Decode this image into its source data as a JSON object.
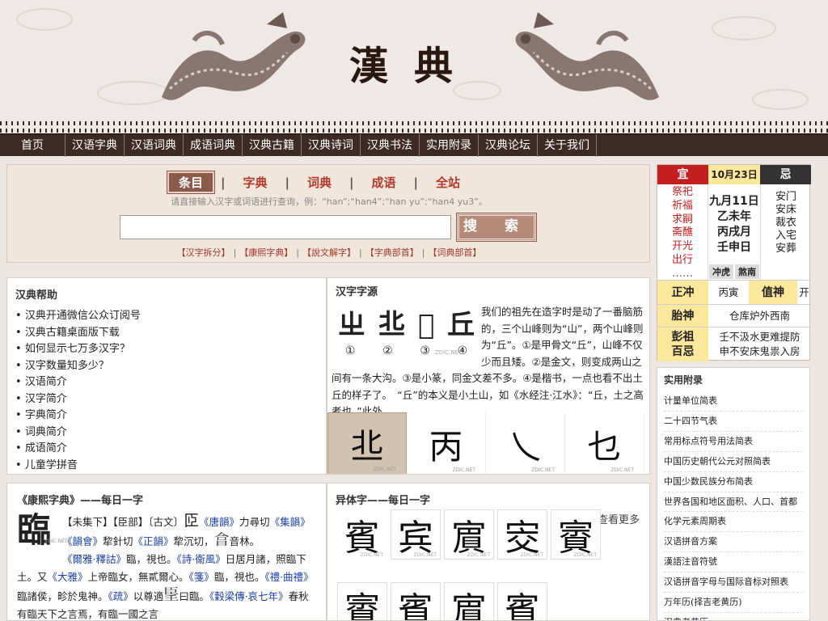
{
  "site": {
    "logo": "漢典"
  },
  "nav": [
    "首页",
    "汉语字典",
    "汉语词典",
    "成语词典",
    "汉典古籍",
    "汉典诗词",
    "汉典书法",
    "实用附录",
    "汉典论坛",
    "关于我们"
  ],
  "search": {
    "tabs": [
      "条目",
      "字典",
      "词典",
      "成语",
      "全站"
    ],
    "active_tab": "条目",
    "hint": "请直接输入汉字或词语进行查询，例：“han”;“han4”;“han yu”;“han4 yu3”。",
    "query": "",
    "button": "搜 索",
    "links": [
      "【汉字拆分】",
      "【康熙字典】",
      "【說文解字】",
      "【字典部首】",
      "【词典部首】"
    ]
  },
  "help": {
    "title": "汉典帮助",
    "items": [
      "汉典开通微信公众订阅号",
      "汉典古籍桌面版下载",
      "如何显示七万多汉字？",
      "汉字数量知多少？",
      "汉语简介",
      "汉字简介",
      "字典简介",
      "词典简介",
      "成语简介",
      "儿童学拼音"
    ]
  },
  "origin": {
    "title": "汉字字源",
    "glyph_numbers": [
      "①",
      "②",
      "③",
      "④"
    ],
    "glyphs": [
      "ㄓ",
      "丠",
      "𠀉",
      "丘"
    ],
    "watermark": "ZDIC.NET",
    "text": "我们的祖先在造字时是动了一番脑筋的，三个山峰则为“山”，两个山峰则为“丘”。①是甲骨文“丘”，山峰不仅少而且矮。②是金文，则变成两山之间有一条大沟。③是小篆，同金文差不多。④是楷书，一点也看不出土丘的样子了。　“丘”的本义是小土山，如《水经注·江水》：“丘，土之高者也。”此外，",
    "strip": [
      "丠",
      "丙",
      "乀",
      "乜"
    ],
    "strip_wm": "ZDIC.NET"
  },
  "kangxi": {
    "title": "《康熙字典》——每日一字",
    "char": "臨",
    "wm": "ZDIC.NET",
    "small1": "𦣝",
    "small2": "𦣠",
    "small3": "𣌭",
    "t1": "【未集下】【臣部】〔古文〕",
    "t2": "《唐韻》",
    "t3": "力尋切",
    "t4": "《集韻》《韻會》",
    "t5": "犂針切",
    "t6": "《正韻》",
    "t7": "犂沉切，",
    "t8": "音林。",
    "t9": "《爾雅·釋詁》",
    "t10": "臨，視也。",
    "t11": "《詩·衞風》",
    "t12": "日居月諸，照臨下土。又",
    "t13": "《大雅》",
    "t14": "上帝臨女，無貳爾心。",
    "t15": "《箋》",
    "t16": "臨，視也。",
    "t17": "《禮·曲禮》",
    "t18": "臨諸侯，畛於鬼神。",
    "t19": "《疏》",
    "t20": "以尊適",
    "t21": "曰臨。",
    "t22": "《穀梁傳·哀七年》",
    "t23": "春秋有臨天下之言焉，有臨一國之言"
  },
  "variant": {
    "title": "异体字——每日一字",
    "more": "查看更多",
    "chars": [
      "賓",
      "宾",
      "賔",
      "㝔",
      "賨",
      "賨",
      "賓",
      "賔",
      "賓"
    ],
    "wm": "ZDIC.NET"
  },
  "almanac": {
    "yi_label": "宜",
    "date": "10月23日",
    "ji_label": "忌",
    "yi": [
      "祭祀",
      "祈福",
      "求嗣",
      "斋醮",
      "开光",
      "出行",
      "……"
    ],
    "lunar": [
      "九月11日",
      "乙未年",
      "丙戌月",
      "壬申日"
    ],
    "chong_tags": [
      "冲虎",
      "煞南"
    ],
    "ji": [
      "安门",
      "安床",
      "裁衣",
      "入宅",
      "安葬"
    ],
    "zhengchong_label": "正冲",
    "zhengchong": "丙寅",
    "zhishen_label": "值神",
    "zhishen": "开",
    "taishen_label": "胎神",
    "taishen": "仓库炉外西南",
    "pengzu_label": "彭祖百忌",
    "pengzu": [
      "壬不汲水更难提防",
      "申不安床鬼祟入房"
    ]
  },
  "appendix": {
    "title": "实用附录",
    "items": [
      "计量单位简表",
      "二十四节气表",
      "常用标点符号用法简表",
      "中国历史朝代公元对照简表",
      "中国少数民族分布简表",
      "世界各国和地区面积、人口、首都",
      "化学元素周期表",
      "汉语拼音方案",
      "漢語注音符號",
      "汉语拼音字母与国际音标对照表",
      "万年历(择吉老黄历)",
      "汉典老黄历"
    ]
  },
  "colors": {
    "nav_bg": "#3e2a25",
    "accent_red": "#a3362a",
    "link_blue": "#1b3fa2"
  }
}
